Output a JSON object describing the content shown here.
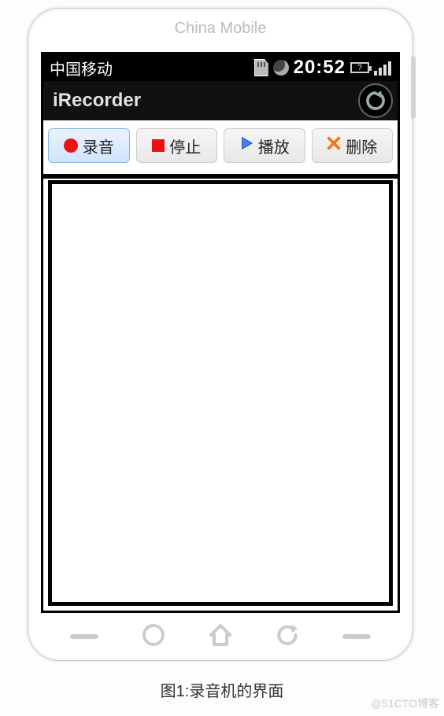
{
  "phone": {
    "brand_label": "China Mobile"
  },
  "statusbar": {
    "carrier": "中国移动",
    "time": "20:52",
    "battery_text": "?"
  },
  "titlebar": {
    "app_name": "iRecorder"
  },
  "toolbar": {
    "record_label": "录音",
    "stop_label": "停止",
    "play_label": "播放",
    "delete_label": "删除"
  },
  "caption": "图1:录音机的界面",
  "watermark": "@51CTO博客"
}
